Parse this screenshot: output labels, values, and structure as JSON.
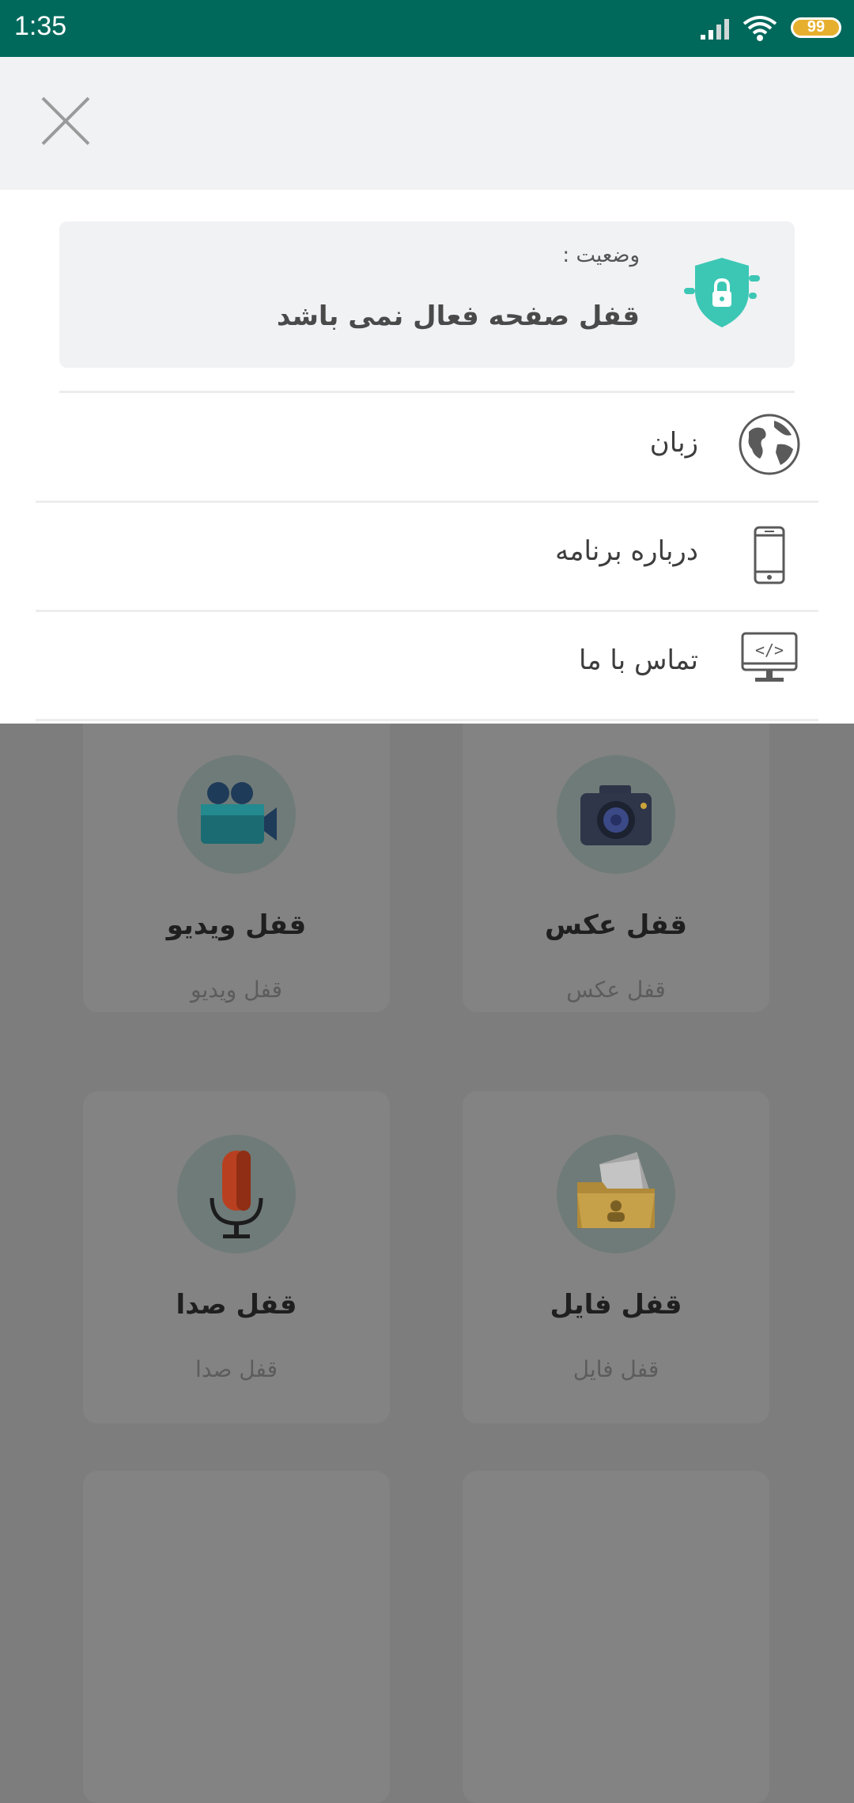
{
  "status_bar": {
    "time": "1:35",
    "battery": "99"
  },
  "drawer": {
    "status": {
      "label": "وضعیت :",
      "value": "قفل صفحه فعال نمی باشد"
    },
    "menu": [
      {
        "label": "زبان",
        "icon": "globe-icon"
      },
      {
        "label": "درباره برنامه",
        "icon": "phone-icon"
      },
      {
        "label": "تماس با ما",
        "icon": "code-monitor-icon"
      }
    ]
  },
  "cards": [
    {
      "title": "قفل ویدیو",
      "subtitle": "قفل ویدیو",
      "icon": "video-camera-icon"
    },
    {
      "title": "قفل عکس",
      "subtitle": "قفل عکس",
      "icon": "photo-camera-icon"
    },
    {
      "title": "قفل صدا",
      "subtitle": "قفل صدا",
      "icon": "microphone-icon"
    },
    {
      "title": "قفل فایل",
      "subtitle": "قفل فایل",
      "icon": "folder-icon"
    }
  ],
  "colors": {
    "status_bar": "#00695c",
    "accent": "#3cc7b5"
  }
}
